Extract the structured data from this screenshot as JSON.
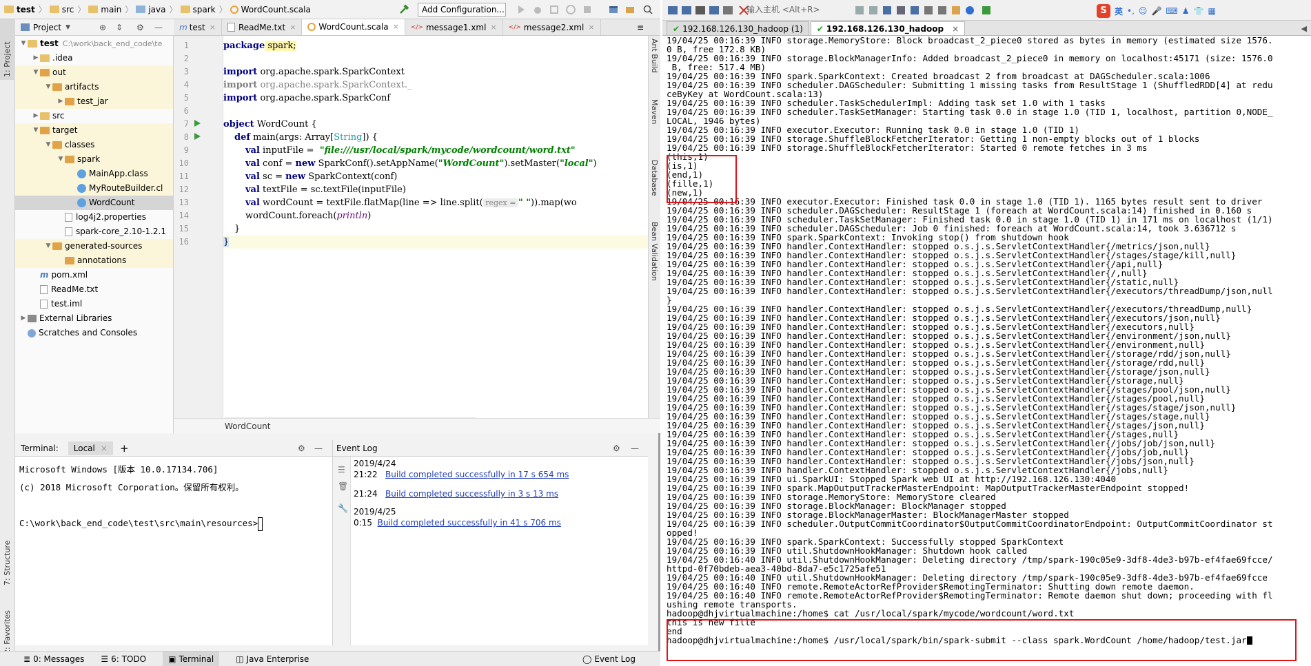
{
  "ide": {
    "breadcrumbs": [
      "test",
      "src",
      "main",
      "java",
      "spark",
      "WordCount.scala"
    ],
    "add_config_label": "Add Configuration...",
    "left_strip": {
      "project": "1: Project",
      "structure": "7: Structure",
      "favorites": "2: Favorites"
    },
    "right_strip": {
      "ant": "Ant Build",
      "maven": "Maven",
      "database": "Database",
      "bean": "Bean Validation"
    },
    "project_panel": {
      "title": "Project",
      "tree": [
        {
          "label": "test",
          "extra": "C:\\work\\back_end_code\\te",
          "indent": 0,
          "arrow": "▼",
          "icon": "folder"
        },
        {
          "label": ".idea",
          "indent": 1,
          "arrow": "▶",
          "icon": "folder"
        },
        {
          "label": "out",
          "indent": 1,
          "arrow": "▼",
          "icon": "folder-orange"
        },
        {
          "label": "artifacts",
          "indent": 2,
          "arrow": "▼",
          "icon": "folder-orange"
        },
        {
          "label": "test_jar",
          "indent": 3,
          "arrow": "▶",
          "icon": "folder-orange"
        },
        {
          "label": "src",
          "indent": 1,
          "arrow": "▶",
          "icon": "folder"
        },
        {
          "label": "target",
          "indent": 1,
          "arrow": "▼",
          "icon": "folder-orange"
        },
        {
          "label": "classes",
          "indent": 2,
          "arrow": "▼",
          "icon": "folder-orange"
        },
        {
          "label": "spark",
          "indent": 3,
          "arrow": "▼",
          "icon": "folder-orange"
        },
        {
          "label": "MainApp.class",
          "indent": 4,
          "arrow": "",
          "icon": "class"
        },
        {
          "label": "MyRouteBuilder.cl",
          "indent": 4,
          "arrow": "",
          "icon": "class"
        },
        {
          "label": "WordCount",
          "indent": 4,
          "arrow": "",
          "icon": "class",
          "selected": true
        },
        {
          "label": "log4j2.properties",
          "indent": 3,
          "arrow": "",
          "icon": "file"
        },
        {
          "label": "spark-core_2.10-1.2.1",
          "indent": 3,
          "arrow": "",
          "icon": "file"
        },
        {
          "label": "generated-sources",
          "indent": 2,
          "arrow": "▼",
          "icon": "folder-orange"
        },
        {
          "label": "annotations",
          "indent": 3,
          "arrow": "",
          "icon": "folder-orange"
        },
        {
          "label": "pom.xml",
          "indent": 1,
          "arrow": "",
          "icon": "maven"
        },
        {
          "label": "ReadMe.txt",
          "indent": 1,
          "arrow": "",
          "icon": "file"
        },
        {
          "label": "test.iml",
          "indent": 1,
          "arrow": "",
          "icon": "file"
        },
        {
          "label": "External Libraries",
          "indent": 0,
          "arrow": "▶",
          "icon": "lib"
        },
        {
          "label": "Scratches and Consoles",
          "indent": 0,
          "arrow": "",
          "icon": "scratch"
        }
      ]
    },
    "editor": {
      "tabs": [
        {
          "label": "test",
          "active": false
        },
        {
          "label": "ReadMe.txt",
          "active": false
        },
        {
          "label": "WordCount.scala",
          "active": true
        },
        {
          "label": "message1.xml",
          "active": false
        },
        {
          "label": "message2.xml",
          "active": false
        }
      ],
      "tab_overflow": "≡",
      "line_numbers": [
        "1",
        "2",
        "3",
        "4",
        "5",
        "6",
        "7",
        "8",
        "9",
        "10",
        "11",
        "12",
        "13",
        "14",
        "15",
        "16"
      ],
      "footer": "WordCount",
      "lines": {
        "l1": {
          "kw": "package",
          "rest": " spark;"
        },
        "l3": {
          "kw": "import",
          "rest": " org.apache.spark.SparkContext"
        },
        "l4": {
          "kw": "import",
          "rest": " org.apache.spark.SparkContext._"
        },
        "l5": {
          "kw": "import",
          "rest": " org.apache.spark.SparkConf"
        },
        "l7": {
          "kw": "object",
          "rest": " WordCount {"
        },
        "l8": {
          "kw": "def",
          "rest": " main(args: Array[",
          "type": "String",
          "end": "]) {"
        },
        "l9": {
          "kw": "val",
          "rest": " inputFile =  ",
          "str": "\"file:///usr/local/spark/mycode/wordcount/word.txt\""
        },
        "l10": {
          "kw": "val",
          "rest": " conf = ",
          "kw2": "new",
          "rest2": " SparkConf().setAppName(",
          "str": "\"WordCount\"",
          "rest3": ").setMaster(",
          "str2": "\"local\"",
          "end": ")"
        },
        "l11": {
          "kw": "val",
          "rest": " sc = ",
          "kw2": "new",
          "rest2": " SparkContext(conf)"
        },
        "l12": {
          "kw": "val",
          "rest": " textFile = sc.textFile(inputFile)"
        },
        "l13": {
          "kw": "val",
          "rest": " wordCount = textFile.flatMap(line => line.split(",
          "hint": " regex = ",
          "str": "\" \"",
          "end": ")).map(wo"
        },
        "l14": {
          "rest": "wordCount.foreach(",
          "it": "println",
          "end": ")"
        },
        "l15": {
          "rest": "}"
        },
        "l16": {
          "rest": "}"
        }
      }
    },
    "terminal": {
      "title": "Terminal:",
      "tab": "Local",
      "add": "+",
      "lines": [
        "Microsoft Windows [版本 10.0.17134.706]",
        "(c) 2018 Microsoft Corporation。保留所有权利。",
        "",
        "C:\\work\\back_end_code\\test\\src\\main\\resources>"
      ]
    },
    "event_log": {
      "title": "Event Log",
      "entries": [
        {
          "date": "2019/4/24",
          "time": "21:22",
          "text": "Build completed successfully in 17 s 654 ms"
        },
        {
          "date": "",
          "time": "21:24",
          "text": "Build completed successfully in 3 s 13 ms"
        },
        {
          "date": "2019/4/25",
          "time": "0:15",
          "text": "Build completed successfully in 41 s 706 ms"
        }
      ]
    },
    "statusbar": [
      {
        "label": "0: Messages",
        "active": false
      },
      {
        "label": "6: TODO",
        "active": false
      },
      {
        "label": "Terminal",
        "active": true
      },
      {
        "label": "Java Enterprise",
        "active": false
      },
      {
        "label": "Event Log",
        "active": false
      }
    ]
  },
  "xshell": {
    "host_input_placeholder": "输入主机 <Alt+R>",
    "ime_label": "英",
    "tabs": [
      {
        "label": "192.168.126.130_hadoop (1)",
        "active": false
      },
      {
        "label": "192.168.126.130_hadoop",
        "active": true
      }
    ],
    "log_lines": [
      "19/04/25 00:16:39 INFO storage.MemoryStore: Block broadcast_2_piece0 stored as bytes in memory (estimated size 1576.",
      "0 B, free 172.8 KB)",
      "19/04/25 00:16:39 INFO storage.BlockManagerInfo: Added broadcast_2_piece0 in memory on localhost:45171 (size: 1576.0",
      " B, free: 517.4 MB)",
      "19/04/25 00:16:39 INFO spark.SparkContext: Created broadcast 2 from broadcast at DAGScheduler.scala:1006",
      "19/04/25 00:16:39 INFO scheduler.DAGScheduler: Submitting 1 missing tasks from ResultStage 1 (ShuffledRDD[4] at redu",
      "ceByKey at WordCount.scala:13)",
      "19/04/25 00:16:39 INFO scheduler.TaskSchedulerImpl: Adding task set 1.0 with 1 tasks",
      "19/04/25 00:16:39 INFO scheduler.TaskSetManager: Starting task 0.0 in stage 1.0 (TID 1, localhost, partition 0,NODE_",
      "LOCAL, 1946 bytes)",
      "19/04/25 00:16:39 INFO executor.Executor: Running task 0.0 in stage 1.0 (TID 1)",
      "19/04/25 00:16:39 INFO storage.ShuffleBlockFetcherIterator: Getting 1 non-empty blocks out of 1 blocks",
      "19/04/25 00:16:39 INFO storage.ShuffleBlockFetcherIterator: Started 0 remote fetches in 3 ms",
      "(this,1)",
      "(is,1)",
      "(end,1)",
      "(fille,1)",
      "(new,1)",
      "19/04/25 00:16:39 INFO executor.Executor: Finished task 0.0 in stage 1.0 (TID 1). 1165 bytes result sent to driver",
      "19/04/25 00:16:39 INFO scheduler.DAGScheduler: ResultStage 1 (foreach at WordCount.scala:14) finished in 0.160 s",
      "19/04/25 00:16:39 INFO scheduler.TaskSetManager: Finished task 0.0 in stage 1.0 (TID 1) in 171 ms on localhost (1/1)",
      "19/04/25 00:16:39 INFO scheduler.DAGScheduler: Job 0 finished: foreach at WordCount.scala:14, took 3.636712 s",
      "19/04/25 00:16:39 INFO spark.SparkContext: Invoking stop() from shutdown hook",
      "19/04/25 00:16:39 INFO handler.ContextHandler: stopped o.s.j.s.ServletContextHandler{/metrics/json,null}",
      "19/04/25 00:16:39 INFO handler.ContextHandler: stopped o.s.j.s.ServletContextHandler{/stages/stage/kill,null}",
      "19/04/25 00:16:39 INFO handler.ContextHandler: stopped o.s.j.s.ServletContextHandler{/api,null}",
      "19/04/25 00:16:39 INFO handler.ContextHandler: stopped o.s.j.s.ServletContextHandler{/,null}",
      "19/04/25 00:16:39 INFO handler.ContextHandler: stopped o.s.j.s.ServletContextHandler{/static,null}",
      "19/04/25 00:16:39 INFO handler.ContextHandler: stopped o.s.j.s.ServletContextHandler{/executors/threadDump/json,null",
      "}",
      "19/04/25 00:16:39 INFO handler.ContextHandler: stopped o.s.j.s.ServletContextHandler{/executors/threadDump,null}",
      "19/04/25 00:16:39 INFO handler.ContextHandler: stopped o.s.j.s.ServletContextHandler{/executors/json,null}",
      "19/04/25 00:16:39 INFO handler.ContextHandler: stopped o.s.j.s.ServletContextHandler{/executors,null}",
      "19/04/25 00:16:39 INFO handler.ContextHandler: stopped o.s.j.s.ServletContextHandler{/environment/json,null}",
      "19/04/25 00:16:39 INFO handler.ContextHandler: stopped o.s.j.s.ServletContextHandler{/environment,null}",
      "19/04/25 00:16:39 INFO handler.ContextHandler: stopped o.s.j.s.ServletContextHandler{/storage/rdd/json,null}",
      "19/04/25 00:16:39 INFO handler.ContextHandler: stopped o.s.j.s.ServletContextHandler{/storage/rdd,null}",
      "19/04/25 00:16:39 INFO handler.ContextHandler: stopped o.s.j.s.ServletContextHandler{/storage/json,null}",
      "19/04/25 00:16:39 INFO handler.ContextHandler: stopped o.s.j.s.ServletContextHandler{/storage,null}",
      "19/04/25 00:16:39 INFO handler.ContextHandler: stopped o.s.j.s.ServletContextHandler{/stages/pool/json,null}",
      "19/04/25 00:16:39 INFO handler.ContextHandler: stopped o.s.j.s.ServletContextHandler{/stages/pool,null}",
      "19/04/25 00:16:39 INFO handler.ContextHandler: stopped o.s.j.s.ServletContextHandler{/stages/stage/json,null}",
      "19/04/25 00:16:39 INFO handler.ContextHandler: stopped o.s.j.s.ServletContextHandler{/stages/stage,null}",
      "19/04/25 00:16:39 INFO handler.ContextHandler: stopped o.s.j.s.ServletContextHandler{/stages/json,null}",
      "19/04/25 00:16:39 INFO handler.ContextHandler: stopped o.s.j.s.ServletContextHandler{/stages,null}",
      "19/04/25 00:16:39 INFO handler.ContextHandler: stopped o.s.j.s.ServletContextHandler{/jobs/job/json,null}",
      "19/04/25 00:16:39 INFO handler.ContextHandler: stopped o.s.j.s.ServletContextHandler{/jobs/job,null}",
      "19/04/25 00:16:39 INFO handler.ContextHandler: stopped o.s.j.s.ServletContextHandler{/jobs/json,null}",
      "19/04/25 00:16:39 INFO handler.ContextHandler: stopped o.s.j.s.ServletContextHandler{/jobs,null}",
      "19/04/25 00:16:39 INFO ui.SparkUI: Stopped Spark web UI at http://192.168.126.130:4040",
      "19/04/25 00:16:39 INFO spark.MapOutputTrackerMasterEndpoint: MapOutputTrackerMasterEndpoint stopped!",
      "19/04/25 00:16:39 INFO storage.MemoryStore: MemoryStore cleared",
      "19/04/25 00:16:39 INFO storage.BlockManager: BlockManager stopped",
      "19/04/25 00:16:39 INFO storage.BlockManagerMaster: BlockManagerMaster stopped",
      "19/04/25 00:16:39 INFO scheduler.OutputCommitCoordinator$OutputCommitCoordinatorEndpoint: OutputCommitCoordinator st",
      "opped!",
      "19/04/25 00:16:39 INFO spark.SparkContext: Successfully stopped SparkContext",
      "19/04/25 00:16:39 INFO util.ShutdownHookManager: Shutdown hook called",
      "19/04/25 00:16:40 INFO util.ShutdownHookManager: Deleting directory /tmp/spark-190c05e9-3df8-4de3-b97b-ef4fae69fcce/",
      "httpd-0f70bdeb-aea3-40bd-8da7-e5c1725afe51",
      "19/04/25 00:16:40 INFO util.ShutdownHookManager: Deleting directory /tmp/spark-190c05e9-3df8-4de3-b97b-ef4fae69fcce",
      "19/04/25 00:16:40 INFO remote.RemoteActorRefProvider$RemotingTerminator: Shutting down remote daemon.",
      "19/04/25 00:16:40 INFO remote.RemoteActorRefProvider$RemotingTerminator: Remote daemon shut down; proceeding with fl",
      "ushing remote transports.",
      "hadoop@dhjvirtualmachine:/home$ cat /usr/local/spark/mycode/wordcount/word.txt",
      "this is new fille",
      "end",
      "hadoop@dhjvirtualmachine:/home$ /usr/local/spark/bin/spark-submit --class spark.WordCount /home/hadoop/test.jar"
    ]
  },
  "colors": {
    "highlight_box": "#e1141a",
    "link": "#2440b3",
    "keyword": "#000080",
    "string": "#008000"
  }
}
